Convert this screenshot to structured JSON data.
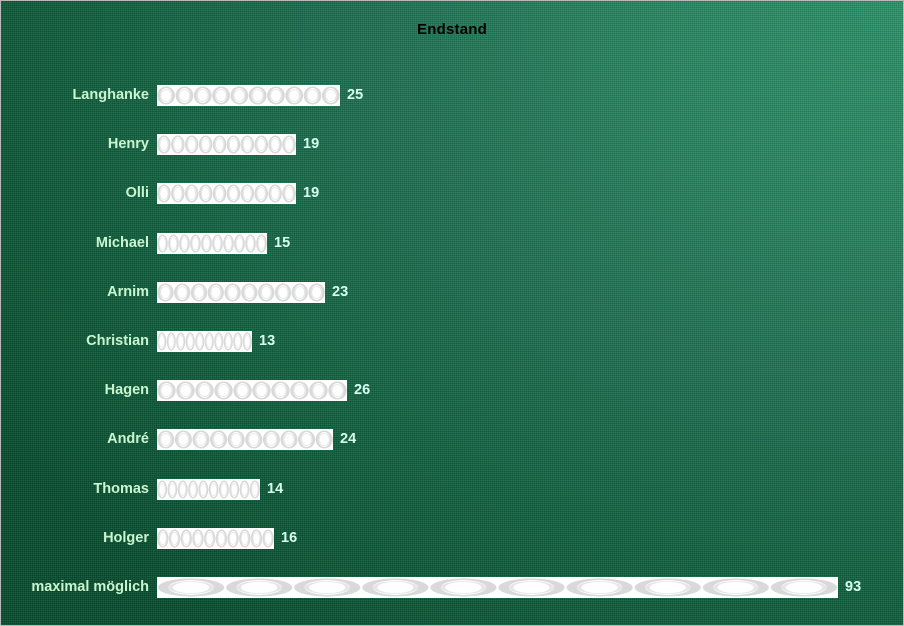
{
  "chart_data": {
    "type": "bar",
    "title": "Endstand",
    "orientation": "horizontal",
    "xlabel": "",
    "ylabel": "",
    "grid": false,
    "legend": "none",
    "xlim": [
      0,
      93
    ],
    "categories": [
      "Langhanke",
      "Henry",
      "Olli",
      "Michael",
      "Arnim",
      "Christian",
      "Hagen",
      "André",
      "Thomas",
      "Holger",
      "maximal möglich"
    ],
    "values": [
      25,
      19,
      19,
      15,
      23,
      13,
      26,
      24,
      14,
      16,
      93
    ],
    "data_labels": [
      "25",
      "19",
      "19",
      "15",
      "23",
      "13",
      "26",
      "24",
      "14",
      "16",
      "93"
    ]
  },
  "style": {
    "title_color": "#000000",
    "label_color": "#c9f5cf",
    "value_color": "#d6fff2",
    "bar_fill": "#ffffff",
    "bar_pattern_color": "#d9d9d9",
    "background_dark": "#0a5434",
    "background_light": "#2f9c70",
    "frame_color": "#b9b9b9"
  }
}
